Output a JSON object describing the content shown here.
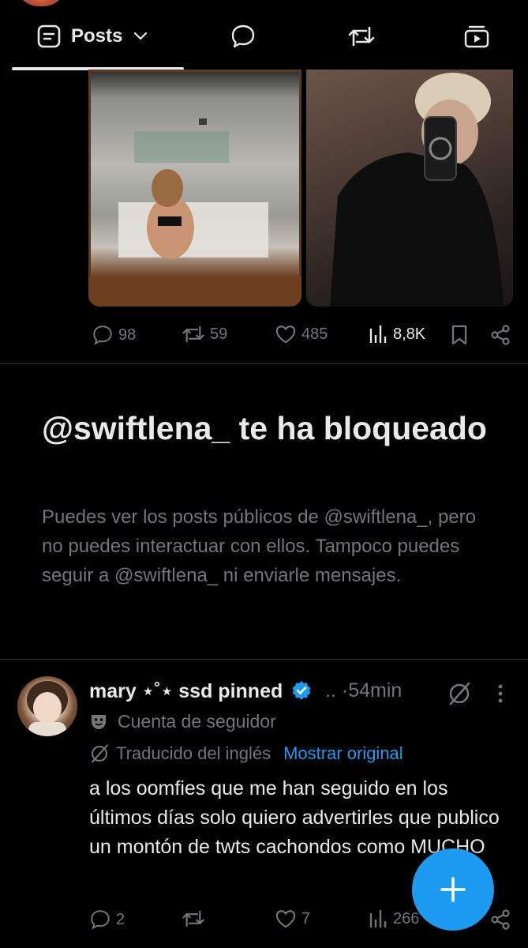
{
  "tabs": {
    "posts_label": "Posts"
  },
  "post_top": {
    "replies": "98",
    "reposts": "59",
    "likes": "485",
    "views": "8,8K"
  },
  "blocked": {
    "title": "@swiftlena_ te ha bloqueado",
    "body": "Puedes ver los posts públicos de @swiftlena_, pero no puedes interactuar con ellos. Tampoco puedes seguir a @swiftlena_ ni enviarle mensajes."
  },
  "tweet": {
    "display_name": "mary ⋆˚⋆ ssd pinned",
    "ellipsis": "..",
    "separator": "·",
    "time": "54min",
    "account_label": "Cuenta de seguidor",
    "translated_label": "Traducido del inglés",
    "show_original": "Mostrar original",
    "text": "a los oomfies que me han seguido en los últimos días solo quiero advertirles que publico un montón de twts cachondos como MUCHO",
    "replies": "2",
    "reposts": "",
    "likes": "7",
    "views": "266"
  },
  "colors": {
    "accent": "#1d9bf0",
    "muted": "#71767b",
    "text": "#e7e9ea",
    "background": "#000000"
  }
}
